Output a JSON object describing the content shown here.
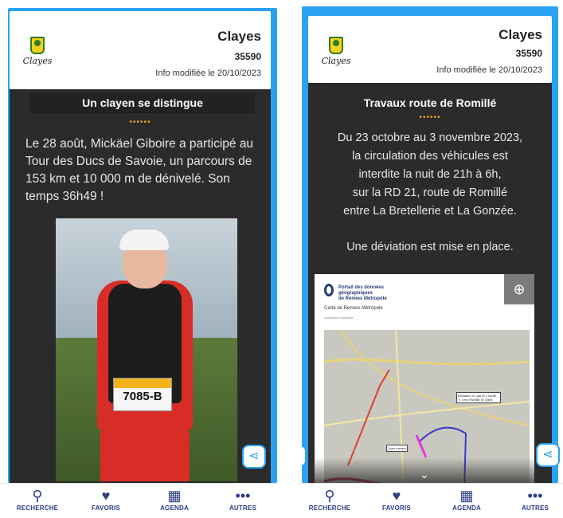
{
  "left": {
    "town": "Clayes",
    "zip": "35590",
    "modified": "Info modifiée le 20/10/2023",
    "logo_text": "Clayes",
    "title": "Un clayen se distingue",
    "dots": "••••••",
    "body": "Le 28 août, Mickäel Giboire a participé au Tour des Ducs de Savoie, un parcours de 153 km et 10 000 m de dénivelé. Son temps 36h49 !",
    "bib_number": "7085-B"
  },
  "right": {
    "town": "Clayes",
    "zip": "35590",
    "modified": "Info modifiée le 20/10/2023",
    "logo_text": "Clayes",
    "title": "Travaux route de Romillé",
    "dots": "••••••",
    "lines": [
      "Du 23 octobre au 3 novembre 2023,",
      "la circulation des véhicules est",
      "interdite la nuit de 21h à 6h,",
      "sur la RD 21, route de Romillé",
      "entre La Bretellerie et La Gonzée."
    ],
    "deviation": "Une déviation est mise en place.",
    "map": {
      "portal_line1": "Portail des données",
      "portal_line2": "géographiques",
      "portal_line3": "de Rennes Métropole",
      "subtitle": "Carte de Rennes Métropole",
      "scale_note": "Impression standard",
      "callout_1": "Déviation VL par la 2 sortie ?/, vers Romillé St Gilles",
      "callout_2": "Zone travaux"
    }
  },
  "nav": {
    "items": [
      {
        "label": "RECHERCHE",
        "icon": "search-icon"
      },
      {
        "label": "FAVORIS",
        "icon": "heart-icon"
      },
      {
        "label": "AGENDA",
        "icon": "calendar-icon"
      },
      {
        "label": "AUTRES",
        "icon": "more-icon"
      }
    ]
  },
  "colors": {
    "frame_blue": "#2aa1f2",
    "content_dark": "#2b2b2b",
    "accent_orange": "#f0a03a",
    "nav_blue": "#2d3d86"
  }
}
